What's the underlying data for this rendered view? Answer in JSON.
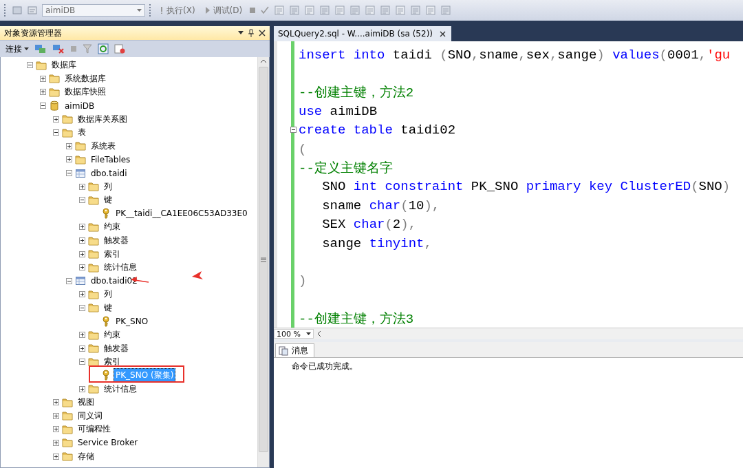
{
  "toolbar": {
    "database": "aimiDB",
    "execute": "执行(X)",
    "debug": "调试(D)"
  },
  "object_explorer": {
    "title": "对象资源管理器",
    "connect": "连接",
    "tree": [
      {
        "label": "数据库",
        "kind": "folder",
        "expanded": true,
        "selected": false,
        "children": [
          {
            "label": "系统数据库",
            "kind": "folder",
            "expanded": false,
            "selected": false
          },
          {
            "label": "数据库快照",
            "kind": "folder",
            "expanded": false,
            "selected": false
          },
          {
            "label": "aimiDB",
            "kind": "database",
            "expanded": true,
            "selected": false,
            "children": [
              {
                "label": "数据库关系图",
                "kind": "folder",
                "expanded": false,
                "selected": false
              },
              {
                "label": "表",
                "kind": "folder",
                "expanded": true,
                "selected": false,
                "children": [
                  {
                    "label": "系统表",
                    "kind": "folder",
                    "expanded": false,
                    "selected": false
                  },
                  {
                    "label": "FileTables",
                    "kind": "folder",
                    "expanded": false,
                    "selected": false
                  },
                  {
                    "label": "dbo.taidi",
                    "kind": "table",
                    "expanded": true,
                    "selected": false,
                    "children": [
                      {
                        "label": "列",
                        "kind": "folder",
                        "expanded": false,
                        "selected": false
                      },
                      {
                        "label": "键",
                        "kind": "folder",
                        "expanded": true,
                        "selected": false,
                        "children": [
                          {
                            "label": "PK__taidi__CA1EE06C53AD33E0",
                            "kind": "key",
                            "selected": false
                          }
                        ]
                      },
                      {
                        "label": "约束",
                        "kind": "folder",
                        "expanded": false,
                        "selected": false
                      },
                      {
                        "label": "触发器",
                        "kind": "folder",
                        "expanded": false,
                        "selected": false
                      },
                      {
                        "label": "索引",
                        "kind": "folder",
                        "expanded": false,
                        "selected": false
                      },
                      {
                        "label": "统计信息",
                        "kind": "folder",
                        "expanded": false,
                        "selected": false
                      }
                    ]
                  },
                  {
                    "label": "dbo.taidi02",
                    "kind": "table",
                    "expanded": true,
                    "selected": false,
                    "children": [
                      {
                        "label": "列",
                        "kind": "folder",
                        "expanded": false,
                        "selected": false
                      },
                      {
                        "label": "键",
                        "kind": "folder",
                        "expanded": true,
                        "selected": false,
                        "children": [
                          {
                            "label": "PK_SNO",
                            "kind": "key",
                            "selected": false
                          }
                        ]
                      },
                      {
                        "label": "约束",
                        "kind": "folder",
                        "expanded": false,
                        "selected": false
                      },
                      {
                        "label": "触发器",
                        "kind": "folder",
                        "expanded": false,
                        "selected": false
                      },
                      {
                        "label": "索引",
                        "kind": "folder",
                        "expanded": true,
                        "selected": false,
                        "children": [
                          {
                            "label": "PK_SNO (聚集)",
                            "kind": "key",
                            "selected": true
                          }
                        ]
                      },
                      {
                        "label": "统计信息",
                        "kind": "folder",
                        "expanded": false,
                        "selected": false
                      }
                    ]
                  }
                ]
              },
              {
                "label": "视图",
                "kind": "folder",
                "expanded": false,
                "selected": false
              },
              {
                "label": "同义词",
                "kind": "folder",
                "expanded": false,
                "selected": false
              },
              {
                "label": "可编程性",
                "kind": "folder",
                "expanded": false,
                "selected": false
              },
              {
                "label": "Service Broker",
                "kind": "folder",
                "expanded": false,
                "selected": false
              },
              {
                "label": "存储",
                "kind": "folder",
                "expanded": false,
                "selected": false
              }
            ]
          }
        ]
      }
    ]
  },
  "editor": {
    "tab": "SQLQuery2.sql - W....aimiDB (sa (52))",
    "zoom": "100 %",
    "lines": [
      {
        "fold": false,
        "tokens": [
          {
            "kind": "keyword",
            "text": "insert into"
          },
          {
            "kind": "plain",
            "text": " taidi "
          },
          {
            "kind": "punct",
            "text": "("
          },
          {
            "kind": "plain",
            "text": "SNO"
          },
          {
            "kind": "punct",
            "text": ","
          },
          {
            "kind": "plain",
            "text": "sname"
          },
          {
            "kind": "punct",
            "text": ","
          },
          {
            "kind": "plain",
            "text": "sex"
          },
          {
            "kind": "punct",
            "text": ","
          },
          {
            "kind": "plain",
            "text": "sange"
          },
          {
            "kind": "punct",
            "text": ") "
          },
          {
            "kind": "keyword",
            "text": "values"
          },
          {
            "kind": "punct",
            "text": "("
          },
          {
            "kind": "plain",
            "text": "0001"
          },
          {
            "kind": "punct",
            "text": ","
          },
          {
            "kind": "string",
            "text": "'gu"
          }
        ]
      },
      {
        "fold": false
      },
      {
        "fold": false,
        "tokens": [
          {
            "kind": "comment",
            "text": "--创建主键，方法2"
          }
        ]
      },
      {
        "fold": false,
        "tokens": [
          {
            "kind": "keyword",
            "text": "use"
          },
          {
            "kind": "plain",
            "text": " aimiDB"
          }
        ]
      },
      {
        "fold": true,
        "tokens": [
          {
            "kind": "keyword",
            "text": "create table"
          },
          {
            "kind": "plain",
            "text": " taidi02"
          }
        ]
      },
      {
        "fold": false,
        "tokens": [
          {
            "kind": "punct",
            "text": "("
          }
        ]
      },
      {
        "fold": false,
        "tokens": [
          {
            "kind": "comment",
            "text": "--定义主键名字"
          }
        ]
      },
      {
        "fold": false,
        "tokens": [
          {
            "kind": "plain",
            "text": "   SNO "
          },
          {
            "kind": "keyword",
            "text": "int constraint"
          },
          {
            "kind": "plain",
            "text": " PK_SNO "
          },
          {
            "kind": "keyword",
            "text": "primary key ClusterED"
          },
          {
            "kind": "punct",
            "text": "("
          },
          {
            "kind": "plain",
            "text": "SNO"
          },
          {
            "kind": "punct",
            "text": ")"
          }
        ]
      },
      {
        "fold": false,
        "tokens": [
          {
            "kind": "plain",
            "text": "   sname "
          },
          {
            "kind": "keyword",
            "text": "char"
          },
          {
            "kind": "punct",
            "text": "("
          },
          {
            "kind": "plain",
            "text": "10"
          },
          {
            "kind": "punct",
            "text": "),"
          }
        ]
      },
      {
        "fold": false,
        "tokens": [
          {
            "kind": "plain",
            "text": "   SEX "
          },
          {
            "kind": "keyword",
            "text": "char"
          },
          {
            "kind": "punct",
            "text": "("
          },
          {
            "kind": "plain",
            "text": "2"
          },
          {
            "kind": "punct",
            "text": "),"
          }
        ]
      },
      {
        "fold": false,
        "tokens": [
          {
            "kind": "plain",
            "text": "   sange "
          },
          {
            "kind": "keyword",
            "text": "tinyint"
          },
          {
            "kind": "punct",
            "text": ","
          }
        ]
      },
      {
        "fold": false
      },
      {
        "fold": false,
        "tokens": [
          {
            "kind": "punct",
            "text": ")"
          }
        ]
      },
      {
        "fold": false
      },
      {
        "fold": false,
        "tokens": [
          {
            "kind": "comment",
            "text": "--创建主键，方法3"
          }
        ]
      }
    ]
  },
  "results": {
    "tab": "消息",
    "message": "命令已成功完成。"
  }
}
